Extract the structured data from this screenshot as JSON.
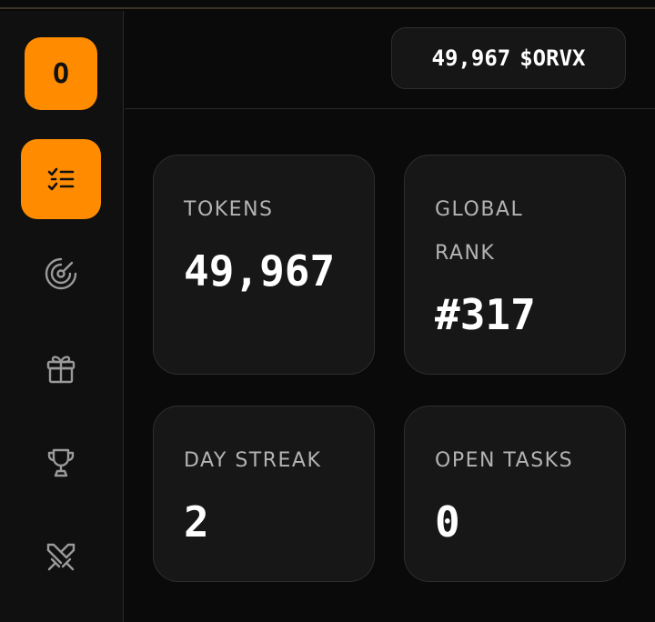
{
  "sidebar": {
    "logo_text": "O",
    "items": [
      {
        "icon": "tasks-checklist-icon",
        "active": true
      },
      {
        "icon": "radar-icon",
        "active": false
      },
      {
        "icon": "gift-icon",
        "active": false
      },
      {
        "icon": "trophy-icon",
        "active": false
      },
      {
        "icon": "swords-icon",
        "active": false
      }
    ]
  },
  "header": {
    "balance_amount": "49,967",
    "balance_symbol": "$ORVX"
  },
  "stats": {
    "tokens": {
      "label": "TOKENS",
      "value": "49,967"
    },
    "rank": {
      "label": "GLOBAL RANK",
      "value": "#317"
    },
    "streak": {
      "label": "DAY STREAK",
      "value": "2"
    },
    "tasks": {
      "label": "OPEN TASKS",
      "value": "0"
    }
  },
  "colors": {
    "accent": "#ff8c00",
    "background": "#0a0a0a",
    "card": "#171717",
    "label": "#b3b3b3"
  }
}
